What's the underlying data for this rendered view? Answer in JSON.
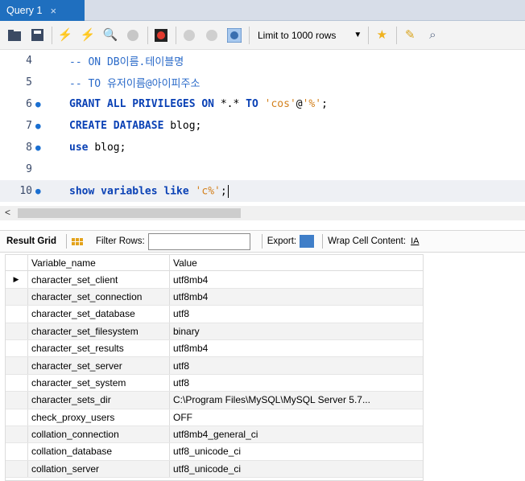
{
  "tab": {
    "title": "Query 1",
    "close": "×"
  },
  "toolbar": {
    "icons": [
      "open-folder-icon",
      "save-icon",
      "execute-icon",
      "execute-selection-icon",
      "explain-icon",
      "stop-icon",
      "toggle-results-icon",
      "commit-icon",
      "rollback-icon",
      "autocommit-icon",
      "bookmark-icon",
      "beautify-icon",
      "find-icon"
    ],
    "limit_label": "Limit to 1000 rows",
    "limit_arrow": "▼"
  },
  "editor": {
    "lines": [
      {
        "num": "4",
        "dot": "",
        "parts": [
          {
            "t": "-- ON DB이름.테이블명",
            "c": "cm"
          }
        ]
      },
      {
        "num": "5",
        "dot": "",
        "parts": [
          {
            "t": "-- TO 유저이름@아이피주소",
            "c": "cm"
          }
        ]
      },
      {
        "num": "6",
        "dot": "●",
        "parts": [
          {
            "t": "GRANT ALL PRIVILEGES ON ",
            "c": "kw"
          },
          {
            "t": "*.*",
            "c": "pl"
          },
          {
            "t": " TO ",
            "c": "kw"
          },
          {
            "t": "'cos'",
            "c": "str"
          },
          {
            "t": "@",
            "c": "pl"
          },
          {
            "t": "'%'",
            "c": "str"
          },
          {
            "t": ";",
            "c": "pl"
          }
        ]
      },
      {
        "num": "7",
        "dot": "●",
        "parts": [
          {
            "t": "CREATE DATABASE ",
            "c": "kw"
          },
          {
            "t": "blog;",
            "c": "pl"
          }
        ]
      },
      {
        "num": "8",
        "dot": "●",
        "parts": [
          {
            "t": "use ",
            "c": "kw"
          },
          {
            "t": "blog;",
            "c": "pl"
          }
        ]
      },
      {
        "num": "9",
        "dot": "",
        "parts": []
      },
      {
        "num": "10",
        "dot": "●",
        "parts": [
          {
            "t": "show variables like ",
            "c": "kw"
          },
          {
            "t": "'c%'",
            "c": "str"
          },
          {
            "t": ";",
            "c": "pl"
          }
        ],
        "current": true
      }
    ]
  },
  "hscroll": {
    "left_arrow": "<"
  },
  "result_toolbar": {
    "result_grid_label": "Result Grid",
    "filter_label": "Filter Rows:",
    "filter_value": "",
    "export_label": "Export:",
    "wrap_label": "Wrap Cell Content:",
    "wrap_icon": "IA"
  },
  "grid": {
    "columns": [
      "Variable_name",
      "Value"
    ],
    "row_marker": "▶",
    "rows": [
      [
        "character_set_client",
        "utf8mb4"
      ],
      [
        "character_set_connection",
        "utf8mb4"
      ],
      [
        "character_set_database",
        "utf8"
      ],
      [
        "character_set_filesystem",
        "binary"
      ],
      [
        "character_set_results",
        "utf8mb4"
      ],
      [
        "character_set_server",
        "utf8"
      ],
      [
        "character_set_system",
        "utf8"
      ],
      [
        "character_sets_dir",
        "C:\\Program Files\\MySQL\\MySQL Server 5.7..."
      ],
      [
        "check_proxy_users",
        "OFF"
      ],
      [
        "collation_connection",
        "utf8mb4_general_ci"
      ],
      [
        "collation_database",
        "utf8_unicode_ci"
      ],
      [
        "collation_server",
        "utf8_unicode_ci"
      ]
    ]
  }
}
